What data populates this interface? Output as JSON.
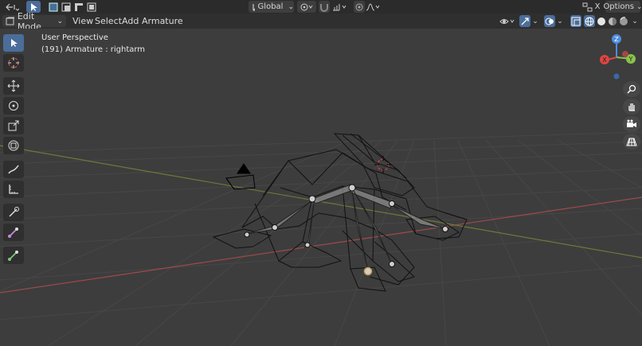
{
  "topbar": {
    "orientation": "Global",
    "options_label": "Options",
    "close_label": "X"
  },
  "header": {
    "mode": "Edit Mode",
    "menus": [
      "View",
      "Select",
      "Add",
      "Armature"
    ]
  },
  "viewport": {
    "perspective_label": "User Perspective",
    "object_info": "(191) Armature : rightarm"
  },
  "gizmo": {
    "z_label": "Z",
    "y_label": "Y",
    "x_label": "X"
  },
  "colors": {
    "accent_active": "#4a6d9a",
    "axis_red": "#a04a4a",
    "axis_green": "#6b7a3a",
    "axis_x": "#e04444",
    "axis_y": "#8bc34a",
    "axis_z": "#4d8de0"
  },
  "icons": {
    "tools": [
      "select-box-icon",
      "cursor-icon",
      "move-icon",
      "rotate-icon",
      "scale-icon",
      "transform-icon",
      "annotate-icon",
      "measure-icon",
      "bone-roll-icon",
      "extrude-icon",
      "bone-size-icon"
    ],
    "nav": [
      "zoom-icon",
      "hand-pan-icon",
      "camera-icon",
      "grid-perspective-icon"
    ]
  }
}
